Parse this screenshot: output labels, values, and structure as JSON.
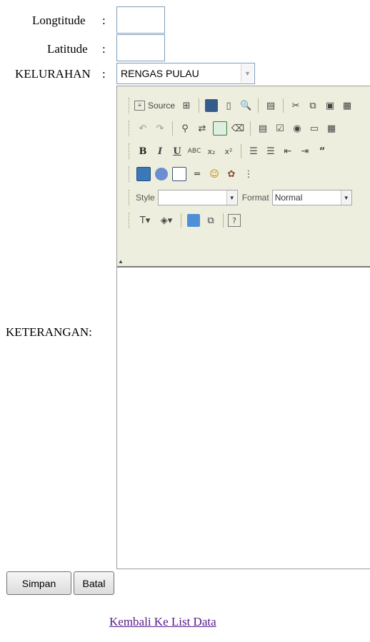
{
  "form": {
    "longitude_label": "Longtitude",
    "latitude_label": "Latitude",
    "kelurahan_label": "KELURAHAN",
    "keterangan_label": "KETERANGAN:",
    "colon": ":",
    "longitude_value": "",
    "latitude_value": "",
    "kelurahan_selected": "RENGAS PULAU"
  },
  "editor": {
    "source_label": "Source",
    "style_label": "Style",
    "style_value": "",
    "format_label": "Format",
    "format_value": "Normal",
    "content": ""
  },
  "buttons": {
    "save_label": "Simpan",
    "cancel_label": "Batal"
  },
  "links": {
    "back_label": "Kembali Ke List Data"
  },
  "colors": {
    "toolbar_bg": "#eeeede",
    "link": "#551a8b",
    "input_border": "#7f9db9"
  }
}
